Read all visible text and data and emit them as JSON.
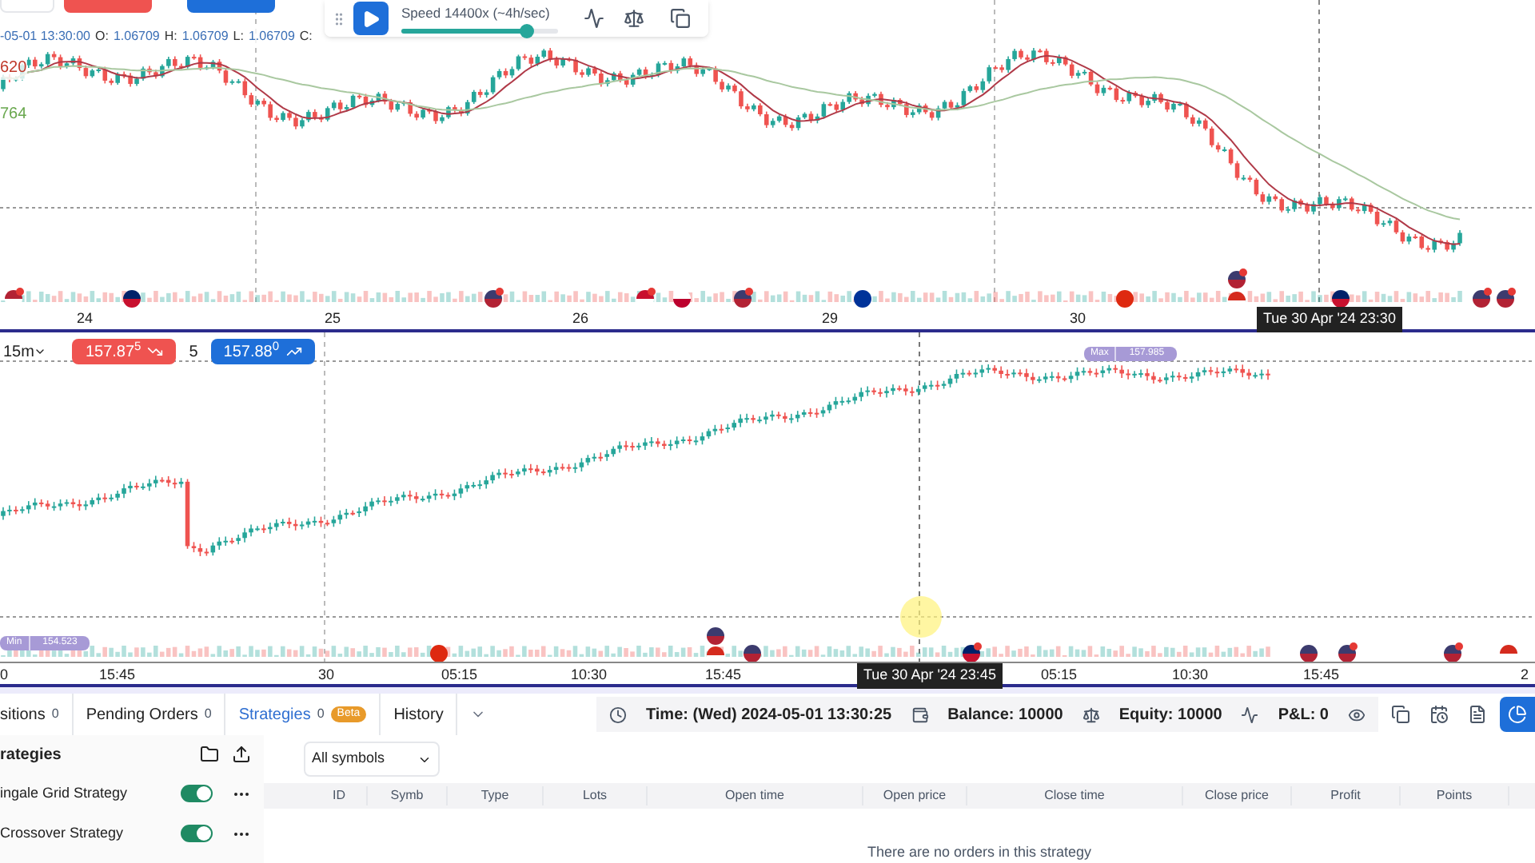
{
  "top_chart": {
    "ohlc": {
      "time": "-05-01 13:30:00",
      "open_label": "O:",
      "open": "1.06709",
      "high_label": "H:",
      "high": "1.06709",
      "low_label": "L:",
      "low": "1.06709",
      "close_label": "C:"
    },
    "indicator_values": [
      {
        "text": "620",
        "color": "#c0392b"
      },
      {
        "text": "764",
        "color": "#6aa84f"
      }
    ],
    "playback": {
      "speed": "Speed 14400x (~4h/sec)",
      "level": 0.8
    },
    "x_axis": [
      "24",
      "25",
      "26",
      "29",
      "30"
    ],
    "crosshair_time": "Tue 30 Apr '24 23:30"
  },
  "bottom_chart": {
    "timeframe": "15m",
    "sell_price": "157.87$^{5}$",
    "spread": "5",
    "buy_price": "157.88$^{0}$",
    "max_label": "Max",
    "max_value": "157.985",
    "min_label": "Min",
    "min_value": "154.523",
    "x_axis": [
      "0",
      "15:45",
      "30",
      "05:15",
      "10:30",
      "15:45",
      "05:15",
      "10:30",
      "15:45",
      "2"
    ],
    "crosshair_time": "Tue 30 Apr '24 23:45"
  },
  "tabs": [
    {
      "label": "sitions",
      "count": "0",
      "selected": false
    },
    {
      "label": "Pending Orders",
      "count": "0",
      "selected": false
    },
    {
      "label": "Strategies",
      "count": "0",
      "badge": "Beta",
      "selected": true
    },
    {
      "label": "History",
      "selected": false
    }
  ],
  "status": {
    "time": "Time: (Wed) 2024-05-01 13:30:25",
    "balance": "Balance: 10000",
    "equity": "Equity: 10000",
    "pnl": "P&L: 0"
  },
  "strategies": {
    "title": "rategies",
    "items": [
      {
        "name": "ingale Grid Strategy",
        "on": true
      },
      {
        "name": "Crossover Strategy",
        "on": true
      }
    ]
  },
  "filter": "All symbols",
  "table": {
    "columns": [
      "ID",
      "Symb",
      "Type",
      "Lots",
      "Open time",
      "Open price",
      "Close time",
      "Close price",
      "Profit",
      "Points"
    ],
    "empty_message": "There are no orders in this strategy"
  }
}
